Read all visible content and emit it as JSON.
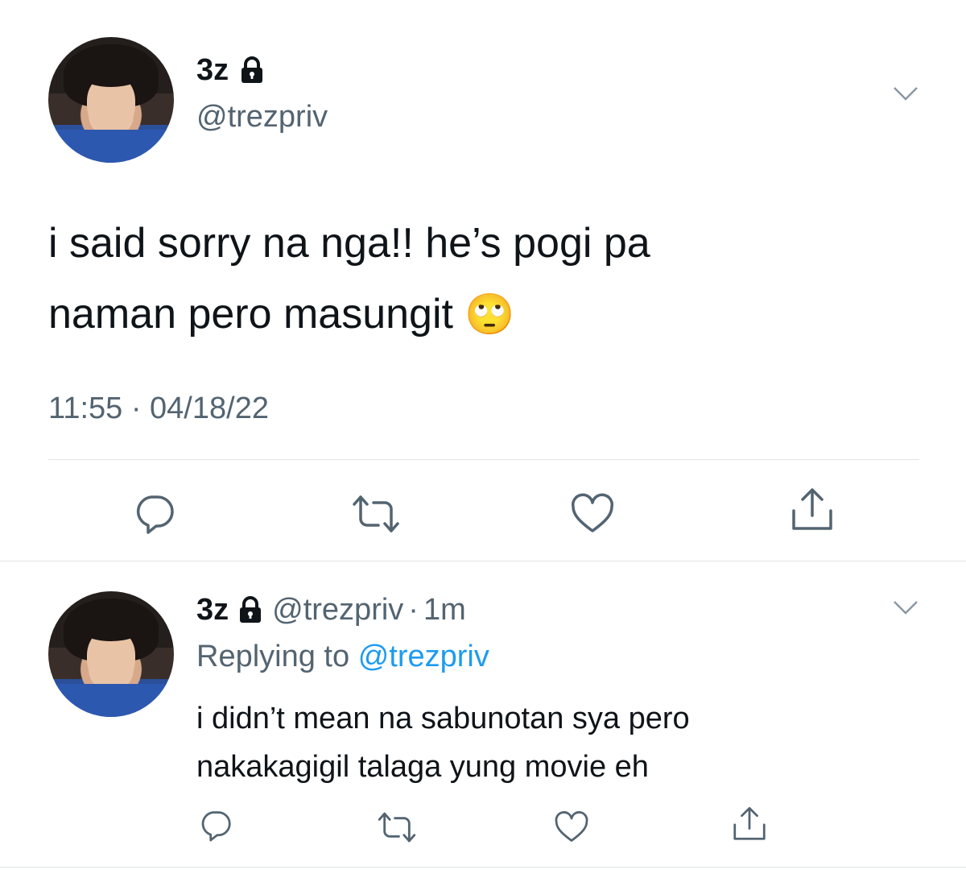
{
  "main_tweet": {
    "author_name": "3z",
    "handle": "@trezpriv",
    "text_line1": "i said sorry na nga!! he’s pogi pa",
    "text_line2": "naman pero masungit",
    "emoji": "🙄",
    "timestamp": "11:55 · 04/18/22"
  },
  "reply_tweet": {
    "author_name": "3z",
    "handle": "@trezpriv",
    "separator": "·",
    "time_ago": "1m",
    "replying_prefix": "Replying to",
    "replying_handle": "@trezpriv",
    "text_line1": "i didn’t mean na sabunotan sya pero",
    "text_line2": "nakakagigil talaga yung movie eh"
  },
  "colors": {
    "text": "#0f1419",
    "muted": "#536471",
    "link": "#1d9bf0",
    "icon": "#536471",
    "divider": "#e1e5e8"
  },
  "icons": [
    "lock-icon",
    "chevron-down-icon",
    "reply-icon",
    "retweet-icon",
    "like-icon",
    "share-icon"
  ]
}
